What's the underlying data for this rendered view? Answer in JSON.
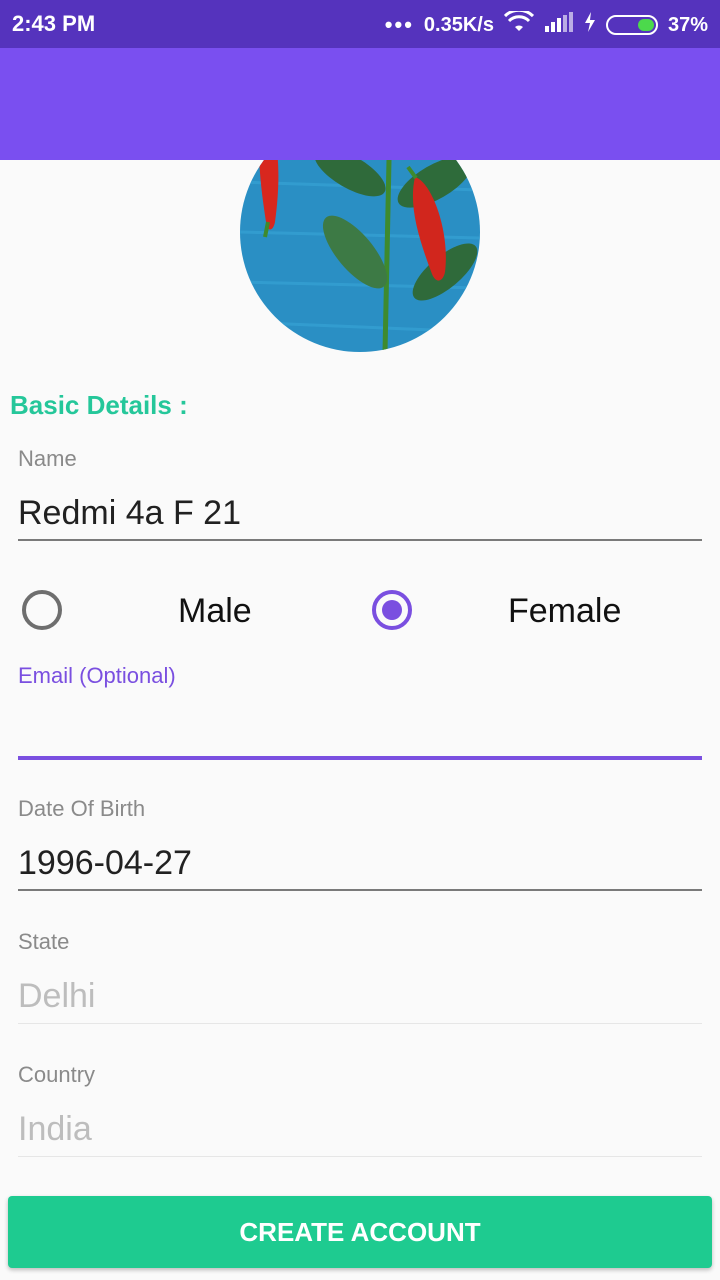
{
  "status_bar": {
    "time": "2:43 PM",
    "network_speed": "0.35K/s",
    "battery": "37%",
    "battery_level": 0.37,
    "icons": [
      "more-dots-icon",
      "wifi-icon",
      "signal-icon",
      "charging-icon",
      "battery-icon"
    ]
  },
  "colors": {
    "status_bar": "#5533bd",
    "app_bar": "#7a4ff0",
    "accent": "#7a4fe0",
    "section_title": "#25c79a",
    "button": "#1ecb90"
  },
  "profile": {
    "image": "chili-peppers-on-blue-wood-photo"
  },
  "form": {
    "section_title": "Basic Details :",
    "name": {
      "label": "Name",
      "value": "Redmi 4a F 21"
    },
    "gender": {
      "options": [
        "Male",
        "Female"
      ],
      "selected": "Female"
    },
    "email": {
      "label": "Email (Optional)",
      "value": ""
    },
    "dob": {
      "label": "Date Of Birth",
      "value": "1996-04-27"
    },
    "state": {
      "label": "State",
      "placeholder": "Delhi"
    },
    "country": {
      "label": "Country",
      "placeholder": "India"
    }
  },
  "actions": {
    "create_account": "CREATE ACCOUNT"
  }
}
